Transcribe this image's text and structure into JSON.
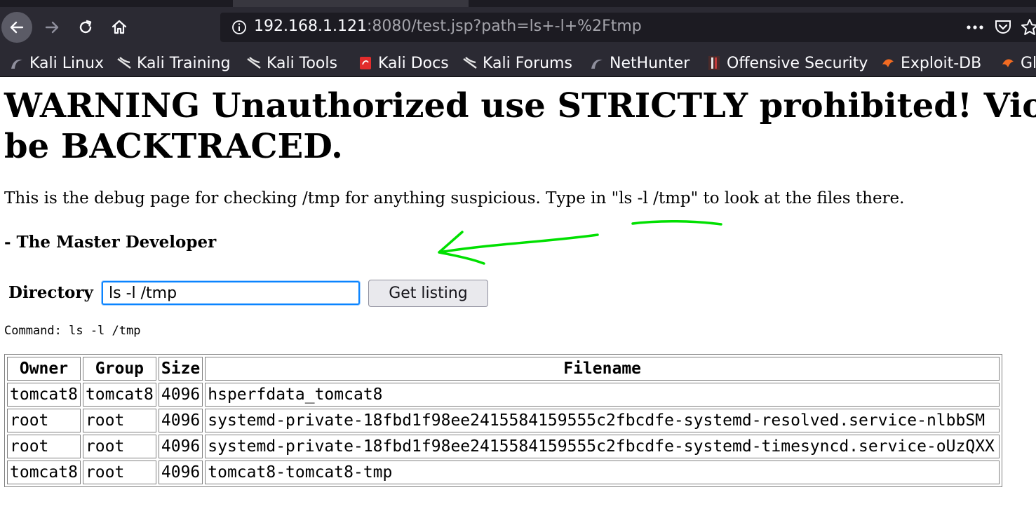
{
  "browser": {
    "url": {
      "host": "192.168.1.121",
      "rest": ":8080/test.jsp?path=ls+-l+%2Ftmp"
    },
    "icons": {
      "back": "arrow-left-icon",
      "forward": "arrow-right-icon",
      "reload": "reload-icon",
      "home": "home-icon",
      "info": "info-icon",
      "more": "more-dots-icon",
      "pocket": "pocket-icon",
      "star": "star-icon"
    },
    "bookmarks": [
      {
        "label": "Kali Linux",
        "icon": "kali-dragon-icon"
      },
      {
        "label": "Kali Training",
        "icon": "kali-dragon-icon"
      },
      {
        "label": "Kali Tools",
        "icon": "kali-dragon-icon"
      },
      {
        "label": "Kali Docs",
        "icon": "kali-docs-icon"
      },
      {
        "label": "Kali Forums",
        "icon": "kali-dragon-icon"
      },
      {
        "label": "NetHunter",
        "icon": "kali-dragon-icon"
      },
      {
        "label": "Offensive Security",
        "icon": "offsec-icon"
      },
      {
        "label": "Exploit-DB",
        "icon": "exploit-db-icon"
      },
      {
        "label": "Gl",
        "icon": "ghdb-icon"
      }
    ],
    "colors": {
      "toolbar": "#2b2a33",
      "urlbar": "#1c1b22",
      "focus": "#0a84ff"
    }
  },
  "page": {
    "warning_line1": "WARNING Unauthorized use STRICTLY prohibited! Vio",
    "warning_line2": "be BACKTRACED.",
    "intro_before": "This is the debug page for checking /tmp for anything suspicious. Type in ",
    "intro_command": "\"ls -l /tmp\"",
    "intro_after": " to look at the files there.",
    "signature": "- The Master Developer",
    "directory_label": "Directory",
    "directory_value": "ls -l /tmp",
    "submit_label": "Get listing",
    "command_line": "Command: ls -l /tmp",
    "annotation_color": "#00e000"
  },
  "listing": {
    "headers": [
      "Owner",
      "Group",
      "Size",
      "Filename"
    ],
    "rows": [
      [
        "tomcat8",
        "tomcat8",
        "4096",
        "hsperfdata_tomcat8"
      ],
      [
        "root",
        "root",
        "4096",
        "systemd-private-18fbd1f98ee2415584159555c2fbcdfe-systemd-resolved.service-nlbbSM"
      ],
      [
        "root",
        "root",
        "4096",
        "systemd-private-18fbd1f98ee2415584159555c2fbcdfe-systemd-timesyncd.service-oUzQXX"
      ],
      [
        "tomcat8",
        "root",
        "4096",
        "tomcat8-tomcat8-tmp"
      ]
    ]
  }
}
